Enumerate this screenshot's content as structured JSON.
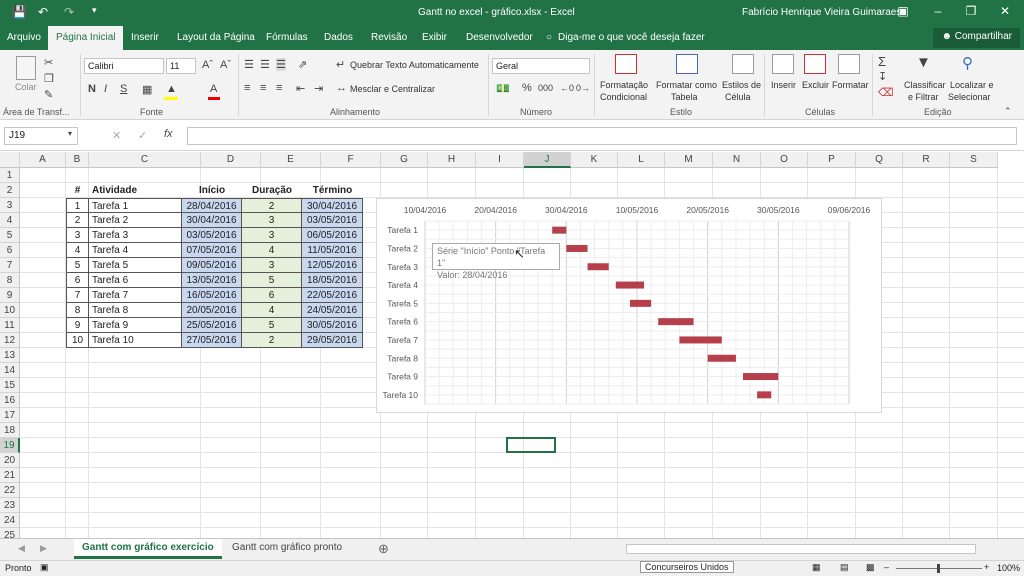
{
  "window": {
    "title": "Gantt no excel - gráfico.xlsx - Excel",
    "user": "Fabrício Henrique Vieira Guimaraes",
    "accent": "#217346"
  },
  "tabs": [
    "Arquivo",
    "Página Inicial",
    "Inserir",
    "Layout da Página",
    "Fórmulas",
    "Dados",
    "Revisão",
    "Exibir",
    "Desenvolvedor"
  ],
  "tellme": "Diga-me o que você deseja fazer",
  "share": "Compartilhar",
  "ribbon": {
    "clipboard": {
      "paste": "Colar",
      "label": "Área de Transf..."
    },
    "font": {
      "name": "Calibri",
      "size": "11",
      "label": "Fonte",
      "bold": "N",
      "italic": "I",
      "underline": "S"
    },
    "alignment": {
      "wrap": "Quebrar Texto Automaticamente",
      "merge": "Mesclar e Centralizar",
      "label": "Alinhamento"
    },
    "number": {
      "format": "Geral",
      "label": "Número",
      "percent": "%",
      "comma": "000"
    },
    "styles": {
      "cond1": "Formatação",
      "cond2": "Condicional",
      "table1": "Formatar como",
      "table2": "Tabela",
      "cell1": "Estilos de",
      "cell2": "Célula",
      "label": "Estilo"
    },
    "cells": {
      "insert": "Inserir",
      "delete": "Excluir",
      "format": "Formatar",
      "label": "Células"
    },
    "editing": {
      "sort1": "Classificar",
      "sort2": "e Filtrar",
      "find1": "Localizar e",
      "find2": "Selecionar",
      "label": "Edição"
    }
  },
  "namebox": "J19",
  "columns": [
    "A",
    "B",
    "C",
    "D",
    "E",
    "F",
    "G",
    "H",
    "I",
    "J",
    "K",
    "L",
    "M",
    "N",
    "O",
    "P",
    "Q",
    "R",
    "S"
  ],
  "rows": [
    "1",
    "2",
    "3",
    "4",
    "5",
    "6",
    "7",
    "8",
    "9",
    "10",
    "11",
    "12",
    "13",
    "14",
    "15",
    "16",
    "17",
    "18",
    "19",
    "20",
    "21",
    "22",
    "23",
    "24",
    "25"
  ],
  "table": {
    "headers": [
      "#",
      "Atividade",
      "Início",
      "Duração",
      "Término"
    ],
    "rows": [
      [
        "1",
        "Tarefa 1",
        "28/04/2016",
        "2",
        "30/04/2016"
      ],
      [
        "2",
        "Tarefa 2",
        "30/04/2016",
        "3",
        "03/05/2016"
      ],
      [
        "3",
        "Tarefa 3",
        "03/05/2016",
        "3",
        "06/05/2016"
      ],
      [
        "4",
        "Tarefa 4",
        "07/05/2016",
        "4",
        "11/05/2016"
      ],
      [
        "5",
        "Tarefa 5",
        "09/05/2016",
        "3",
        "12/05/2016"
      ],
      [
        "6",
        "Tarefa 6",
        "13/05/2016",
        "5",
        "18/05/2016"
      ],
      [
        "7",
        "Tarefa 7",
        "16/05/2016",
        "6",
        "22/05/2016"
      ],
      [
        "8",
        "Tarefa 8",
        "20/05/2016",
        "4",
        "24/05/2016"
      ],
      [
        "9",
        "Tarefa 9",
        "25/05/2016",
        "5",
        "30/05/2016"
      ],
      [
        "10",
        "Tarefa 10",
        "27/05/2016",
        "2",
        "29/05/2016"
      ]
    ]
  },
  "chart_data": {
    "type": "bar",
    "orientation": "horizontal-gantt",
    "categories": [
      "Tarefa 1",
      "Tarefa 2",
      "Tarefa 3",
      "Tarefa 4",
      "Tarefa 5",
      "Tarefa 6",
      "Tarefa 7",
      "Tarefa 8",
      "Tarefa 9",
      "Tarefa 10"
    ],
    "start": [
      "2016-04-28",
      "2016-04-30",
      "2016-05-03",
      "2016-05-07",
      "2016-05-09",
      "2016-05-13",
      "2016-05-16",
      "2016-05-20",
      "2016-05-25",
      "2016-05-27"
    ],
    "duration": [
      2,
      3,
      3,
      4,
      3,
      5,
      6,
      4,
      5,
      2
    ],
    "xticks": [
      "10/04/2016",
      "20/04/2016",
      "30/04/2016",
      "10/05/2016",
      "20/05/2016",
      "30/05/2016",
      "09/06/2016"
    ],
    "xlim": [
      "2016-04-10",
      "2016-06-09"
    ],
    "grid": true,
    "bar_color": "#b5404b"
  },
  "tooltip": {
    "line1": "Série \"Início\" Ponto \"Tarefa 1\"",
    "line2": "Valor: 28/04/2016"
  },
  "sheets": [
    "Gantt com gráfico exercício",
    "Gantt com gráfico pronto"
  ],
  "status": {
    "mode": "Pronto",
    "zoom": "100%",
    "overlay": "Concurseiros Unidos"
  }
}
